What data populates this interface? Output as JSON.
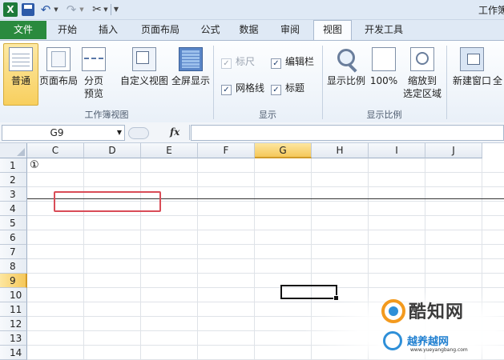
{
  "window": {
    "title": "工作簿"
  },
  "tabs": {
    "file": "文件",
    "home": "开始",
    "insert": "插入",
    "page_layout": "页面布局",
    "formulas": "公式",
    "data": "数据",
    "review": "审阅",
    "view": "视图",
    "developer": "开发工具"
  },
  "ribbon": {
    "workbook_views": {
      "label": "工作簿视图",
      "normal": "普通",
      "page_layout": "页面布局",
      "page_break_1": "分页",
      "page_break_2": "预览",
      "custom_views": "自定义视图",
      "full_screen": "全屏显示"
    },
    "show": {
      "label": "显示",
      "ruler": "标尺",
      "formula_bar": "编辑栏",
      "gridlines": "网格线",
      "headings": "标题",
      "ruler_checked": true,
      "formula_bar_checked": true,
      "gridlines_checked": true,
      "headings_checked": true
    },
    "zoom": {
      "label": "显示比例",
      "zoom": "显示比例",
      "hundred": "100%",
      "zoom_sel_1": "缩放到",
      "zoom_sel_2": "选定区域"
    },
    "window": {
      "new_window": "新建窗口",
      "arrange_all": "全"
    }
  },
  "formula_bar": {
    "name_box": "G9",
    "fx": "fx",
    "value": ""
  },
  "grid": {
    "columns": [
      "C",
      "D",
      "E",
      "F",
      "G",
      "H",
      "I",
      "J"
    ],
    "selected_column": "G",
    "rows": [
      "1",
      "2",
      "3",
      "4",
      "5",
      "6",
      "7",
      "8",
      "9",
      "10",
      "11",
      "12",
      "13",
      "14"
    ],
    "selected_row": "9",
    "cell_c1": "①",
    "active_cell": "G9"
  },
  "watermark": {
    "brand": "酷知网",
    "brand2": "越养越网",
    "url": "www.yueyangbang.com"
  },
  "colors": {
    "file_tab": "#2a8a3e",
    "selection": "#f5c85a",
    "annotation": "#d94c57"
  },
  "icons": [
    "excel-logo-icon",
    "save-icon",
    "undo-icon",
    "redo-icon",
    "tool-icon",
    "customize-icon",
    "fx-icon"
  ]
}
